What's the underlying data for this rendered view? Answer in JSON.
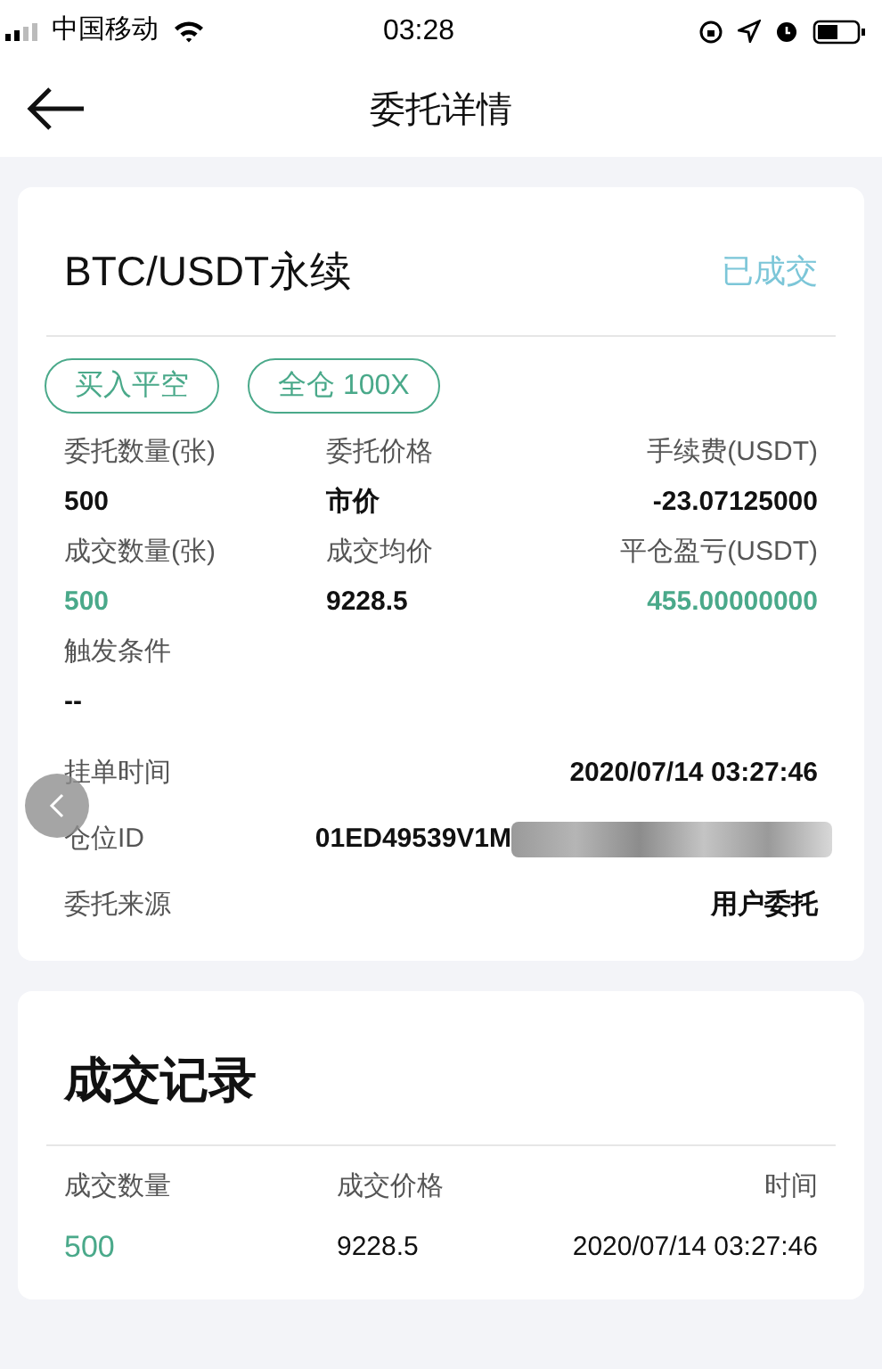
{
  "status_bar": {
    "carrier": "中国移动",
    "time": "03:28"
  },
  "nav": {
    "title": "委托详情"
  },
  "order": {
    "symbol": "BTC/USDT永续",
    "status": "已成交",
    "tags": [
      "买入平空",
      "全仓 100X"
    ],
    "fields": [
      {
        "label": "委托数量(张)",
        "value": "500",
        "accent": false
      },
      {
        "label": "委托价格",
        "value": "市价",
        "accent": false
      },
      {
        "label": "手续费(USDT)",
        "value": "-23.07125000",
        "accent": false
      },
      {
        "label": "成交数量(张)",
        "value": "500",
        "accent": true
      },
      {
        "label": "成交均价",
        "value": "9228.5",
        "accent": false
      },
      {
        "label": "平仓盈亏(USDT)",
        "value": "455.00000000",
        "accent": true
      }
    ],
    "trigger": {
      "label": "触发条件",
      "value": "--"
    },
    "details": [
      {
        "label": "挂单时间",
        "value": "2020/07/14 03:27:46",
        "redacted": false
      },
      {
        "label": "仓位ID",
        "value": "01ED49539V1M",
        "redacted": true
      },
      {
        "label": "委托来源",
        "value": "用户委托",
        "redacted": false
      }
    ]
  },
  "trades": {
    "title": "成交记录",
    "columns": [
      "成交数量",
      "成交价格",
      "时间"
    ],
    "rows": [
      {
        "cells": [
          {
            "text": "500",
            "accent": true
          },
          {
            "text": "9228.5",
            "accent": false
          },
          {
            "text": "2020/07/14 03:27:46",
            "accent": false
          }
        ]
      }
    ]
  }
}
